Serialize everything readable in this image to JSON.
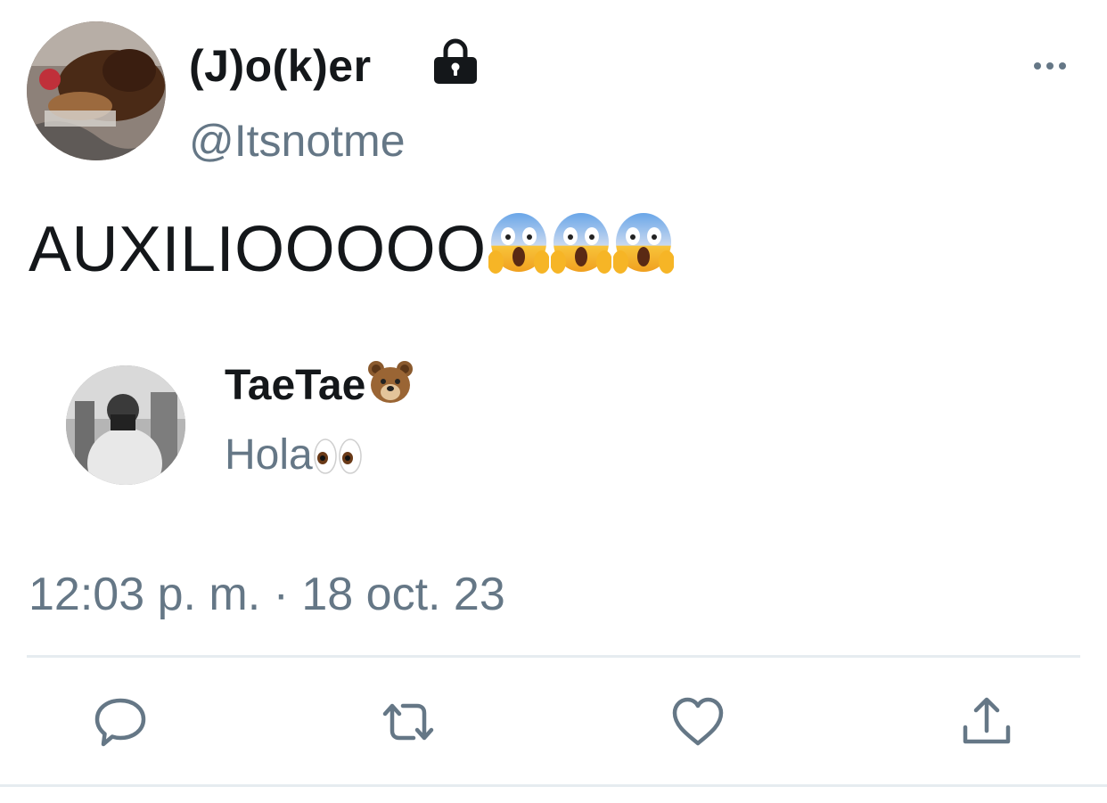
{
  "tweet": {
    "author": {
      "display_name": "(J)o(k)er",
      "handle": "@Itsnotme",
      "locked": true
    },
    "text": "AUXILIOOOOO",
    "emoji": [
      "face-screaming-in-fear",
      "face-screaming-in-fear",
      "face-screaming-in-fear"
    ],
    "quoted": {
      "display_name": "TaeTae",
      "name_emoji": "bear-face",
      "text": "Hola",
      "text_emoji": "eyes"
    },
    "timestamp": "12:03 p. m. · 18 oct. 23"
  },
  "actions": [
    {
      "name": "reply",
      "icon": "reply-icon"
    },
    {
      "name": "retweet",
      "icon": "retweet-icon"
    },
    {
      "name": "like",
      "icon": "heart-icon"
    },
    {
      "name": "share",
      "icon": "share-icon"
    }
  ],
  "colors": {
    "text_primary": "#14171a",
    "text_secondary": "#657786",
    "icon": "#657786",
    "divider": "#e6ecf0"
  }
}
